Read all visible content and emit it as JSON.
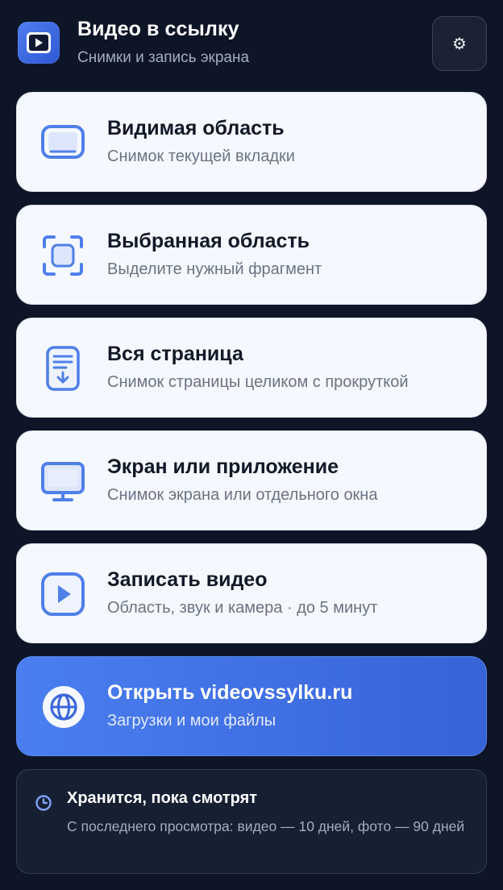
{
  "header": {
    "title": "Видео в ссылку",
    "subtitle": "Снимки и запись экрана",
    "settings_icon": "⚙"
  },
  "actions": [
    {
      "icon": "visible-area-icon",
      "title": "Видимая область",
      "subtitle": "Снимок текущей вкладки"
    },
    {
      "icon": "selection-icon",
      "title": "Выбранная область",
      "subtitle": "Выделите нужный фрагмент"
    },
    {
      "icon": "full-page-icon",
      "title": "Вся страница",
      "subtitle": "Снимок страницы целиком с прокруткой"
    },
    {
      "icon": "monitor-icon",
      "title": "Экран или приложение",
      "subtitle": "Снимок экрана или отдельного окна"
    },
    {
      "icon": "play-icon",
      "title": "Записать видео",
      "subtitle": "Область, звук и камера · до 5 минут"
    }
  ],
  "open_site": {
    "icon": "globe-icon",
    "title": "Открыть videovssylku.ru",
    "subtitle": "Загрузки и мои файлы"
  },
  "info": {
    "icon": "clock-icon",
    "title": "Хранится, пока смотрят",
    "text": "С последнего просмотра: видео — 10 дней, фото — 90 дней"
  },
  "colors": {
    "background": "#0e1527",
    "accent": "#4a7ff0",
    "card": "#f5f8fe",
    "icon_blue": "#4f7fe8"
  }
}
